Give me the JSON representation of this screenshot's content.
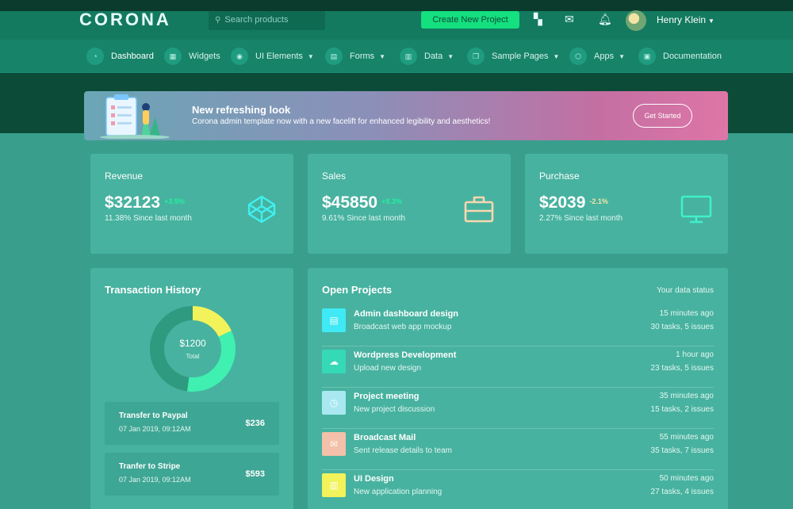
{
  "header": {
    "logo": "CORONA",
    "search_placeholder": "Search products",
    "create_button": "Create New Project",
    "user_name": "Henry Klein",
    "icons": [
      "grid-icon",
      "mail-icon",
      "bell-icon",
      "search-icon",
      "caret-down-icon"
    ]
  },
  "nav": {
    "items": [
      {
        "label": "Dashboard",
        "icon": "speedometer-icon"
      },
      {
        "label": "Widgets",
        "icon": "widgets-icon"
      },
      {
        "label": "UI Elements",
        "icon": "ui-elements-icon"
      },
      {
        "label": "Forms",
        "icon": "forms-icon"
      },
      {
        "label": "Data",
        "icon": "chart-icon"
      },
      {
        "label": "Sample Pages",
        "icon": "pages-icon"
      },
      {
        "label": "Apps",
        "icon": "apps-icon"
      },
      {
        "label": "Documentation",
        "icon": "document-icon"
      }
    ]
  },
  "banner": {
    "title": "New refreshing look",
    "subtitle": "Corona admin template now with a new facelift for enhanced legibility and aesthetics!",
    "button": "Get Started"
  },
  "stats": [
    {
      "label": "Revenue",
      "value": "$32123",
      "change": "+3.5%",
      "change_color": "#22f0a0",
      "since": "11.38% Since last month",
      "icon": "codepen-icon",
      "icon_color": "#3ff0f0"
    },
    {
      "label": "Sales",
      "value": "$45850",
      "change": "+8.3%",
      "change_color": "#22f0a0",
      "since": "9.61% Since last month",
      "icon": "briefcase-icon",
      "icon_color": "#f7d7b0"
    },
    {
      "label": "Purchase",
      "value": "$2039",
      "change": "-2.1%",
      "change_color": "#f2e6a8",
      "since": "2.27% Since last month",
      "icon": "monitor-icon",
      "icon_color": "#3ff0c8"
    }
  ],
  "transactions": {
    "title": "Transaction History",
    "total_value": "$1200",
    "total_label": "Total",
    "donut_segments": [
      {
        "share": 0.18,
        "color": "#f2f25a"
      },
      {
        "share": 0.34,
        "color": "#3ff0b0"
      },
      {
        "share": 0.48,
        "color": "#2f9a7f"
      }
    ],
    "items": [
      {
        "title": "Transfer to Paypal",
        "date": "07 Jan 2019, 09:12AM",
        "amount": "$236"
      },
      {
        "title": "Tranfer to Stripe",
        "date": "07 Jan 2019, 09:12AM",
        "amount": "$593"
      }
    ]
  },
  "projects": {
    "title": "Open Projects",
    "status_label": "Your data status",
    "items": [
      {
        "title": "Admin dashboard design",
        "subtitle": "Broadcast web app mockup",
        "time": "15 minutes ago",
        "tasks": "30 tasks, 5 issues",
        "icon": "file-icon",
        "color": "#3fe9f5"
      },
      {
        "title": "Wordpress Development",
        "subtitle": "Upload new design",
        "time": "1 hour ago",
        "tasks": "23 tasks, 5 issues",
        "icon": "cloud-icon",
        "color": "#36d9b6"
      },
      {
        "title": "Project meeting",
        "subtitle": "New project discussion",
        "time": "35 minutes ago",
        "tasks": "15 tasks, 2 issues",
        "icon": "clock-icon",
        "color": "#a9e8f0"
      },
      {
        "title": "Broadcast Mail",
        "subtitle": "Sent release details to team",
        "time": "55 minutes ago",
        "tasks": "35 tasks, 7 issues",
        "icon": "mail-icon",
        "color": "#f3c0a9"
      },
      {
        "title": "UI Design",
        "subtitle": "New application planning",
        "time": "50 minutes ago",
        "tasks": "27 tasks, 4 issues",
        "icon": "chart-icon",
        "color": "#f2f25a"
      }
    ]
  }
}
